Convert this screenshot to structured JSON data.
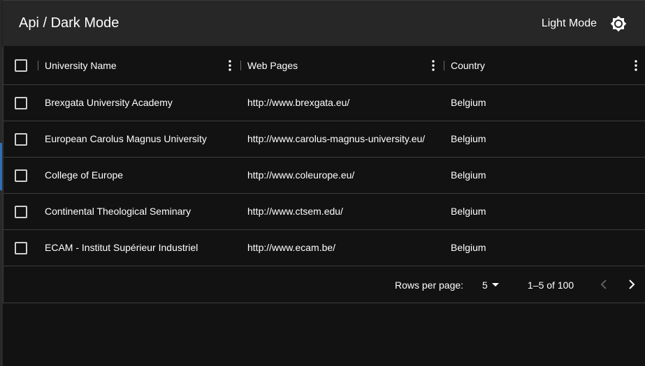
{
  "app": {
    "title": "Api / Dark Mode",
    "mode_label": "Light Mode",
    "mode_icon": "brightness-icon"
  },
  "table": {
    "columns": [
      "University Name",
      "Web Pages",
      "Country"
    ],
    "rows": [
      {
        "name": "Brexgata University Academy",
        "web": "http://www.brexgata.eu/",
        "country": "Belgium"
      },
      {
        "name": "European Carolus Magnus University",
        "web": "http://www.carolus-magnus-university.eu/",
        "country": "Belgium"
      },
      {
        "name": "College of Europe",
        "web": "http://www.coleurope.eu/",
        "country": "Belgium"
      },
      {
        "name": "Continental Theological Seminary",
        "web": "http://www.ctsem.edu/",
        "country": "Belgium"
      },
      {
        "name": "ECAM - Institut Supérieur Industriel",
        "web": "http://www.ecam.be/",
        "country": "Belgium"
      }
    ]
  },
  "pagination": {
    "rows_per_page_label": "Rows per page:",
    "rows_per_page": "5",
    "range": "1–5 of 100"
  },
  "colors": {
    "background": "#121212",
    "appbar": "#272727",
    "divider": "#3d3d3d",
    "text": "#ffffff"
  }
}
